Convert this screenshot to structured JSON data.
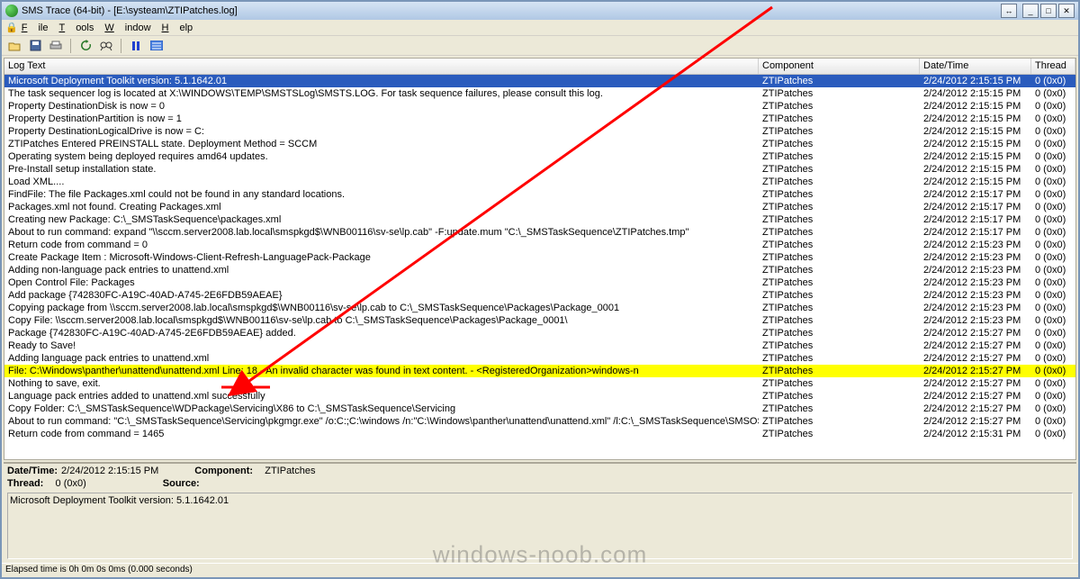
{
  "title": "SMS Trace (64-bit) - [E:\\systeam\\ZTIPatches.log]",
  "menu": {
    "file": "File",
    "tools": "Tools",
    "window": "Window",
    "help": "Help"
  },
  "columns": {
    "text": "Log Text",
    "component": "Component",
    "datetime": "Date/Time",
    "thread": "Thread"
  },
  "rows": [
    {
      "text": "Microsoft Deployment Toolkit version: 5.1.1642.01",
      "comp": "ZTIPatches",
      "dt": "2/24/2012 2:15:15 PM",
      "th": "0 (0x0)",
      "sel": true
    },
    {
      "text": "The task sequencer log is located at X:\\WINDOWS\\TEMP\\SMSTSLog\\SMSTS.LOG.  For task sequence failures, please consult this log.",
      "comp": "ZTIPatches",
      "dt": "2/24/2012 2:15:15 PM",
      "th": "0 (0x0)"
    },
    {
      "text": "Property DestinationDisk is now = 0",
      "comp": "ZTIPatches",
      "dt": "2/24/2012 2:15:15 PM",
      "th": "0 (0x0)"
    },
    {
      "text": "Property DestinationPartition is now = 1",
      "comp": "ZTIPatches",
      "dt": "2/24/2012 2:15:15 PM",
      "th": "0 (0x0)"
    },
    {
      "text": "Property DestinationLogicalDrive is now = C:",
      "comp": "ZTIPatches",
      "dt": "2/24/2012 2:15:15 PM",
      "th": "0 (0x0)"
    },
    {
      "text": "ZTIPatches Entered PREINSTALL state. Deployment Method = SCCM",
      "comp": "ZTIPatches",
      "dt": "2/24/2012 2:15:15 PM",
      "th": "0 (0x0)"
    },
    {
      "text": "Operating system being deployed requires amd64 updates.",
      "comp": "ZTIPatches",
      "dt": "2/24/2012 2:15:15 PM",
      "th": "0 (0x0)"
    },
    {
      "text": "Pre-Install setup installation state.",
      "comp": "ZTIPatches",
      "dt": "2/24/2012 2:15:15 PM",
      "th": "0 (0x0)"
    },
    {
      "text": "Load XML....",
      "comp": "ZTIPatches",
      "dt": "2/24/2012 2:15:15 PM",
      "th": "0 (0x0)"
    },
    {
      "text": "FindFile: The file Packages.xml could not be found in any standard locations.",
      "comp": "ZTIPatches",
      "dt": "2/24/2012 2:15:17 PM",
      "th": "0 (0x0)"
    },
    {
      "text": "Packages.xml not found.  Creating Packages.xml",
      "comp": "ZTIPatches",
      "dt": "2/24/2012 2:15:17 PM",
      "th": "0 (0x0)"
    },
    {
      "text": "Creating new Package: C:\\_SMSTaskSequence\\packages.xml",
      "comp": "ZTIPatches",
      "dt": "2/24/2012 2:15:17 PM",
      "th": "0 (0x0)"
    },
    {
      "text": "About to run command: expand \"\\\\sccm.server2008.lab.local\\smspkgd$\\WNB00116\\sv-se\\lp.cab\" -F:update.mum \"C:\\_SMSTaskSequence\\ZTIPatches.tmp\"",
      "comp": "ZTIPatches",
      "dt": "2/24/2012 2:15:17 PM",
      "th": "0 (0x0)"
    },
    {
      "text": "Return code from command = 0",
      "comp": "ZTIPatches",
      "dt": "2/24/2012 2:15:23 PM",
      "th": "0 (0x0)"
    },
    {
      "text": "    Create Package Item : Microsoft-Windows-Client-Refresh-LanguagePack-Package",
      "comp": "ZTIPatches",
      "dt": "2/24/2012 2:15:23 PM",
      "th": "0 (0x0)"
    },
    {
      "text": "Adding non-language pack entries to unattend.xml",
      "comp": "ZTIPatches",
      "dt": "2/24/2012 2:15:23 PM",
      "th": "0 (0x0)"
    },
    {
      "text": "Open Control File: Packages",
      "comp": "ZTIPatches",
      "dt": "2/24/2012 2:15:23 PM",
      "th": "0 (0x0)"
    },
    {
      "text": "Add package {742830FC-A19C-40AD-A745-2E6FDB59AEAE}",
      "comp": "ZTIPatches",
      "dt": "2/24/2012 2:15:23 PM",
      "th": "0 (0x0)"
    },
    {
      "text": "Copying package from \\\\sccm.server2008.lab.local\\smspkgd$\\WNB00116\\sv-se\\lp.cab to C:\\_SMSTaskSequence\\Packages\\Package_0001",
      "comp": "ZTIPatches",
      "dt": "2/24/2012 2:15:23 PM",
      "th": "0 (0x0)"
    },
    {
      "text": "Copy File: \\\\sccm.server2008.lab.local\\smspkgd$\\WNB00116\\sv-se\\lp.cab to C:\\_SMSTaskSequence\\Packages\\Package_0001\\",
      "comp": "ZTIPatches",
      "dt": "2/24/2012 2:15:23 PM",
      "th": "0 (0x0)"
    },
    {
      "text": "Package {742830FC-A19C-40AD-A745-2E6FDB59AEAE} added.",
      "comp": "ZTIPatches",
      "dt": "2/24/2012 2:15:27 PM",
      "th": "0 (0x0)"
    },
    {
      "text": "Ready to Save!",
      "comp": "ZTIPatches",
      "dt": "2/24/2012 2:15:27 PM",
      "th": "0 (0x0)"
    },
    {
      "text": "Adding language pack entries to unattend.xml",
      "comp": "ZTIPatches",
      "dt": "2/24/2012 2:15:27 PM",
      "th": "0 (0x0)"
    },
    {
      "text": "File: C:\\Windows\\panther\\unattend\\unattend.xml Line: 18 - An invalid character was found in text content. - <RegisteredOrganization>windows-n",
      "comp": "ZTIPatches",
      "dt": "2/24/2012 2:15:27 PM",
      "th": "0 (0x0)",
      "hl": true
    },
    {
      "text": "Nothing to save, exit.",
      "comp": "ZTIPatches",
      "dt": "2/24/2012 2:15:27 PM",
      "th": "0 (0x0)"
    },
    {
      "text": "Language pack entries added to unattend.xml successfully",
      "comp": "ZTIPatches",
      "dt": "2/24/2012 2:15:27 PM",
      "th": "0 (0x0)"
    },
    {
      "text": "Copy Folder: C:\\_SMSTaskSequence\\WDPackage\\Servicing\\X86 to C:\\_SMSTaskSequence\\Servicing",
      "comp": "ZTIPatches",
      "dt": "2/24/2012 2:15:27 PM",
      "th": "0 (0x0)"
    },
    {
      "text": "About to run command: \"C:\\_SMSTaskSequence\\Servicing\\pkgmgr.exe\"  /o:C:;C:\\windows /n:\"C:\\Windows\\panther\\unattend\\unattend.xml\" /l:C:\\_SMSTaskSequence\\SMSOSD\\OSDLOGS\\BDD_pkgmgr.log",
      "comp": "ZTIPatches",
      "dt": "2/24/2012 2:15:27 PM",
      "th": "0 (0x0)"
    },
    {
      "text": "Return code from command = 1465",
      "comp": "ZTIPatches",
      "dt": "2/24/2012 2:15:31 PM",
      "th": "0 (0x0)"
    }
  ],
  "detail": {
    "datetime_label": "Date/Time:",
    "datetime_value": "2/24/2012 2:15:15 PM",
    "component_label": "Component:",
    "component_value": "ZTIPatches",
    "thread_label": "Thread:",
    "thread_value": "0 (0x0)",
    "source_label": "Source:",
    "source_value": "",
    "body": "Microsoft Deployment Toolkit version: 5.1.1642.01"
  },
  "status": "Elapsed time is 0h 0m 0s 0ms (0.000 seconds)",
  "watermark": "windows-noob.com"
}
